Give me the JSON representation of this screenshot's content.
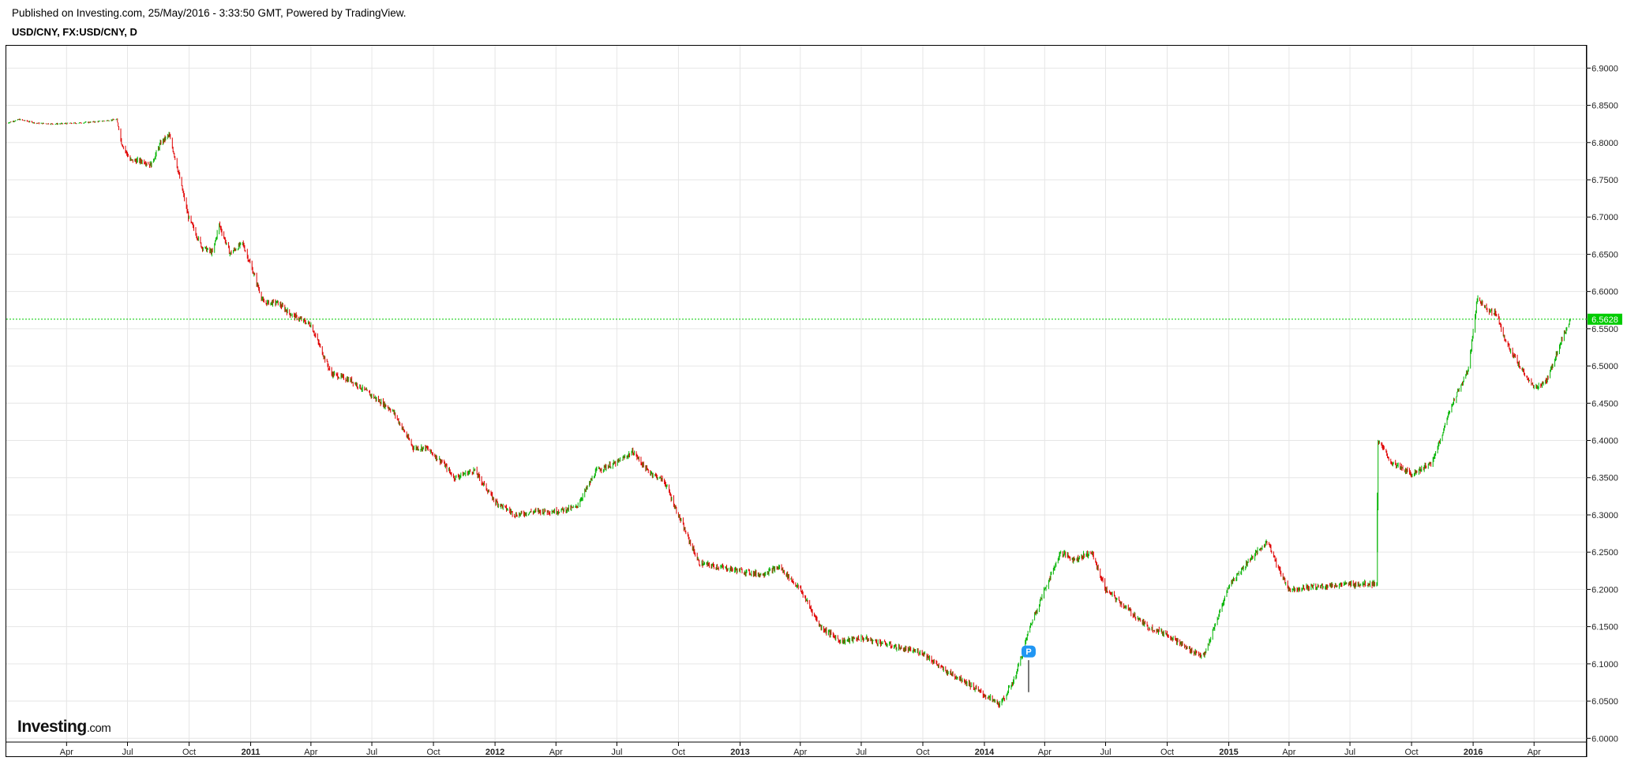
{
  "header": {
    "published": "Published on Investing.com, 25/May/2016 - 3:33:50 GMT, Powered by TradingView.",
    "symbol": "USD/CNY, FX:USD/CNY, D"
  },
  "logo": {
    "brand": "Investing",
    "suffix": ".com"
  },
  "marker": {
    "label": "P",
    "color": "#2196f3"
  },
  "colors": {
    "up": "#00b300",
    "down": "#e00000",
    "neutral": "#777777",
    "last_price_bg": "#00cc00"
  },
  "chart_data": {
    "type": "candlestick",
    "title": "USD/CNY, FX:USD/CNY, D",
    "ylim": [
      5.995,
      6.93
    ],
    "y_ticks": [
      "6.9000",
      "6.8500",
      "6.8000",
      "6.7500",
      "6.7000",
      "6.6500",
      "6.6000",
      "6.5500",
      "6.5000",
      "6.4500",
      "6.4000",
      "6.3500",
      "6.3000",
      "6.2500",
      "6.2000",
      "6.1500",
      "6.1000",
      "6.0500",
      "6.0000"
    ],
    "x_ticks": [
      "Apr",
      "Jul",
      "Oct",
      "2011",
      "Apr",
      "Jul",
      "Oct",
      "2012",
      "Apr",
      "Jul",
      "Oct",
      "2013",
      "Apr",
      "Jul",
      "Oct",
      "2014",
      "Apr",
      "Jul",
      "Oct",
      "2015",
      "Apr",
      "Jul",
      "Oct",
      "2016",
      "Apr"
    ],
    "x_bold": [
      "2011",
      "2012",
      "2013",
      "2014",
      "2015",
      "2016"
    ],
    "xlim": [
      "2010-01-01",
      "2016-06-01"
    ],
    "x_tick_dates": [
      "2010-04-01",
      "2010-07-01",
      "2010-10-01",
      "2011-01-01",
      "2011-04-01",
      "2011-07-01",
      "2011-10-01",
      "2012-01-01",
      "2012-04-01",
      "2012-07-01",
      "2012-10-01",
      "2013-01-01",
      "2013-04-01",
      "2013-07-01",
      "2013-10-01",
      "2014-01-01",
      "2014-04-01",
      "2014-07-01",
      "2014-10-01",
      "2015-01-01",
      "2015-04-01",
      "2015-07-01",
      "2015-10-01",
      "2016-01-01",
      "2016-04-01"
    ],
    "last_price": "6.5628",
    "last_value": 6.5628,
    "price_path": [
      [
        "2010-01-01",
        6.826
      ],
      [
        "2010-01-20",
        6.831
      ],
      [
        "2010-02-15",
        6.826
      ],
      [
        "2010-03-15",
        6.825
      ],
      [
        "2010-04-15",
        6.826
      ],
      [
        "2010-05-15",
        6.828
      ],
      [
        "2010-06-15",
        6.831
      ],
      [
        "2010-06-22",
        6.8
      ],
      [
        "2010-07-05",
        6.776
      ],
      [
        "2010-07-25",
        6.775
      ],
      [
        "2010-08-05",
        6.77
      ],
      [
        "2010-08-20",
        6.8
      ],
      [
        "2010-09-01",
        6.81
      ],
      [
        "2010-09-10",
        6.78
      ],
      [
        "2010-09-30",
        6.7
      ],
      [
        "2010-10-20",
        6.66
      ],
      [
        "2010-11-05",
        6.652
      ],
      [
        "2010-11-15",
        6.69
      ],
      [
        "2010-12-01",
        6.651
      ],
      [
        "2010-12-20",
        6.665
      ],
      [
        "2011-01-05",
        6.625
      ],
      [
        "2011-01-20",
        6.585
      ],
      [
        "2011-02-10",
        6.585
      ],
      [
        "2011-03-01",
        6.57
      ],
      [
        "2011-04-01",
        6.555
      ],
      [
        "2011-05-01",
        6.49
      ],
      [
        "2011-06-01",
        6.48
      ],
      [
        "2011-07-01",
        6.46
      ],
      [
        "2011-08-01",
        6.44
      ],
      [
        "2011-09-01",
        6.39
      ],
      [
        "2011-09-20",
        6.39
      ],
      [
        "2011-10-15",
        6.37
      ],
      [
        "2011-11-01",
        6.35
      ],
      [
        "2011-12-01",
        6.36
      ],
      [
        "2012-01-01",
        6.318
      ],
      [
        "2012-02-01",
        6.3
      ],
      [
        "2012-03-01",
        6.305
      ],
      [
        "2012-04-01",
        6.305
      ],
      [
        "2012-05-01",
        6.31
      ],
      [
        "2012-06-01",
        6.36
      ],
      [
        "2012-07-01",
        6.37
      ],
      [
        "2012-07-25",
        6.385
      ],
      [
        "2012-08-15",
        6.36
      ],
      [
        "2012-09-10",
        6.345
      ],
      [
        "2012-10-10",
        6.28
      ],
      [
        "2012-11-01",
        6.235
      ],
      [
        "2012-12-01",
        6.23
      ],
      [
        "2013-01-01",
        6.225
      ],
      [
        "2013-02-01",
        6.22
      ],
      [
        "2013-03-01",
        6.23
      ],
      [
        "2013-04-01",
        6.2
      ],
      [
        "2013-05-01",
        6.15
      ],
      [
        "2013-06-01",
        6.13
      ],
      [
        "2013-07-01",
        6.135
      ],
      [
        "2013-08-01",
        6.128
      ],
      [
        "2013-09-01",
        6.12
      ],
      [
        "2013-10-01",
        6.115
      ],
      [
        "2013-11-01",
        6.092
      ],
      [
        "2013-12-01",
        6.078
      ],
      [
        "2014-01-01",
        6.058
      ],
      [
        "2014-01-25",
        6.045
      ],
      [
        "2014-02-15",
        6.08
      ],
      [
        "2014-03-10",
        6.15
      ],
      [
        "2014-04-01",
        6.2
      ],
      [
        "2014-04-25",
        6.25
      ],
      [
        "2014-05-15",
        6.24
      ],
      [
        "2014-06-10",
        6.25
      ],
      [
        "2014-07-01",
        6.2
      ],
      [
        "2014-08-01",
        6.175
      ],
      [
        "2014-09-01",
        6.15
      ],
      [
        "2014-10-01",
        6.14
      ],
      [
        "2014-11-01",
        6.12
      ],
      [
        "2014-11-25",
        6.11
      ],
      [
        "2014-12-15",
        6.16
      ],
      [
        "2015-01-01",
        6.205
      ],
      [
        "2015-02-01",
        6.24
      ],
      [
        "2015-03-01",
        6.265
      ],
      [
        "2015-03-15",
        6.23
      ],
      [
        "2015-04-01",
        6.2
      ],
      [
        "2015-05-01",
        6.203
      ],
      [
        "2015-06-01",
        6.205
      ],
      [
        "2015-07-01",
        6.207
      ],
      [
        "2015-08-10",
        6.208
      ],
      [
        "2015-08-12",
        6.4
      ],
      [
        "2015-09-01",
        6.37
      ],
      [
        "2015-10-01",
        6.355
      ],
      [
        "2015-11-01",
        6.37
      ],
      [
        "2015-12-01",
        6.45
      ],
      [
        "2015-12-25",
        6.495
      ],
      [
        "2016-01-07",
        6.59
      ],
      [
        "2016-01-25",
        6.575
      ],
      [
        "2016-02-05",
        6.57
      ],
      [
        "2016-02-20",
        6.53
      ],
      [
        "2016-03-10",
        6.5
      ],
      [
        "2016-04-01",
        6.47
      ],
      [
        "2016-04-20",
        6.48
      ],
      [
        "2016-05-10",
        6.53
      ],
      [
        "2016-05-25",
        6.5628
      ]
    ],
    "marker_date": "2014-03-08",
    "marker_value": 6.115
  }
}
